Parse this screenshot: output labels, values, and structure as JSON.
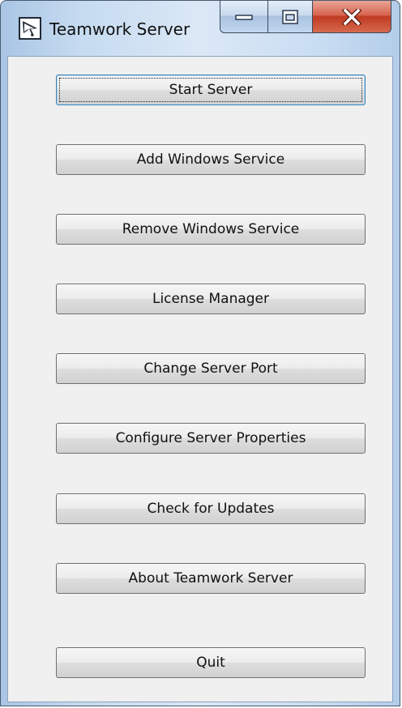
{
  "window": {
    "title": "Teamwork Server",
    "app_icon": "teamwork-server-icon",
    "caption_buttons": {
      "minimize_icon": "minimize-icon",
      "maximize_icon": "maximize-icon",
      "close_icon": "close-icon",
      "close_color": "#c8412b"
    }
  },
  "buttons": {
    "start_server": "Start Server",
    "add_windows_service": "Add Windows Service",
    "remove_windows_service": "Remove Windows Service",
    "license_manager": "License Manager",
    "change_server_port": "Change Server Port",
    "configure_server_properties": "Configure Server Properties",
    "check_for_updates": "Check for Updates",
    "about_teamwork_server": "About Teamwork Server",
    "quit": "Quit"
  },
  "colors": {
    "frame": "#c6dbf0",
    "client_background": "#f0f0f0",
    "default_button_border": "#3c7fb1"
  }
}
